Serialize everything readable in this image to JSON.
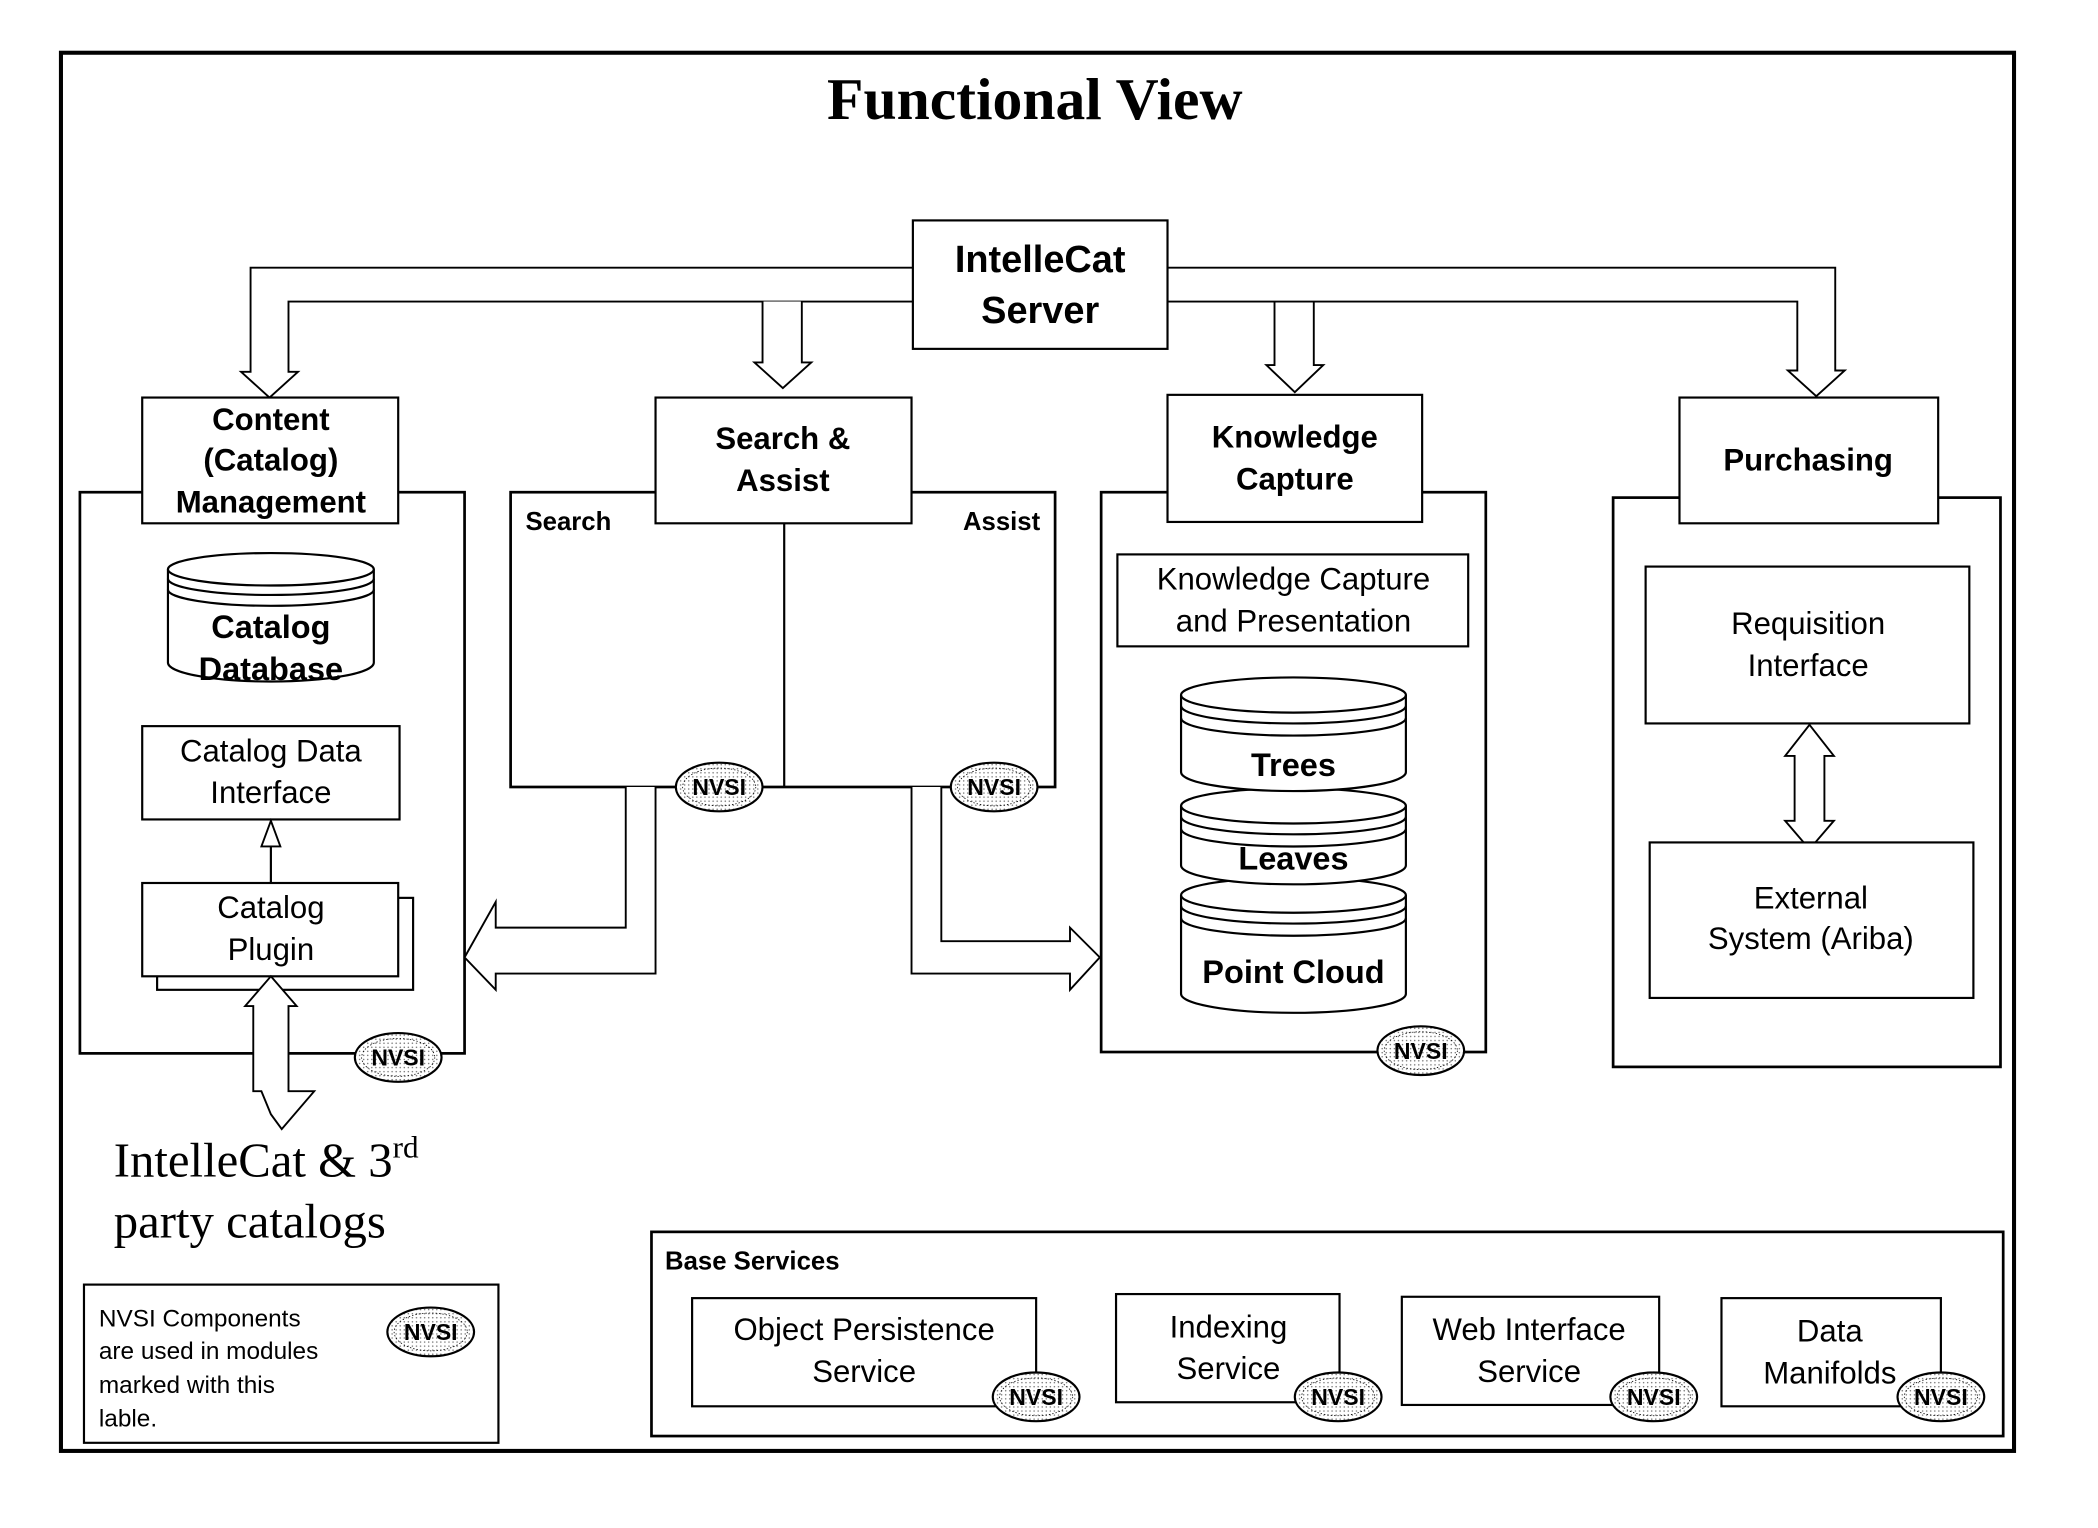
{
  "title": "Functional View",
  "server": {
    "line1": "IntelleCat",
    "line2": "Server"
  },
  "modules": {
    "content": {
      "header": [
        "Content",
        "(Catalog)",
        "Management"
      ],
      "database": [
        "Catalog",
        "Database"
      ],
      "data_interface": [
        "Catalog Data",
        "Interface"
      ],
      "plugin": [
        "Catalog",
        "Plugin"
      ]
    },
    "search_assist": {
      "header": [
        "Search &",
        "Assist"
      ],
      "search_label": "Search",
      "assist_label": "Assist"
    },
    "knowledge": {
      "header": [
        "Knowledge",
        "Capture"
      ],
      "presentation": [
        "Knowledge Capture",
        "and Presentation"
      ],
      "stores": [
        "Trees",
        "Leaves",
        "Point Cloud"
      ]
    },
    "purchasing": {
      "header": "Purchasing",
      "requisition": [
        "Requisition",
        "Interface"
      ],
      "external": [
        "External",
        "System (Ariba)"
      ]
    }
  },
  "external_catalogs": {
    "line1_main": "IntelleCat & 3",
    "line1_sup": "rd",
    "line2": "party catalogs"
  },
  "legend": {
    "lines": [
      "NVSI Components",
      "are used in modules",
      "marked with this",
      "lable."
    ]
  },
  "base_services": {
    "title": "Base Services",
    "services": [
      [
        "Object Persistence",
        "Service"
      ],
      [
        "Indexing",
        "Service"
      ],
      [
        "Web Interface",
        "Service"
      ],
      [
        "Data",
        "Manifolds"
      ]
    ]
  },
  "badge_label": "NVSI",
  "colors": {
    "ink": "#000000",
    "paper": "#ffffff"
  }
}
